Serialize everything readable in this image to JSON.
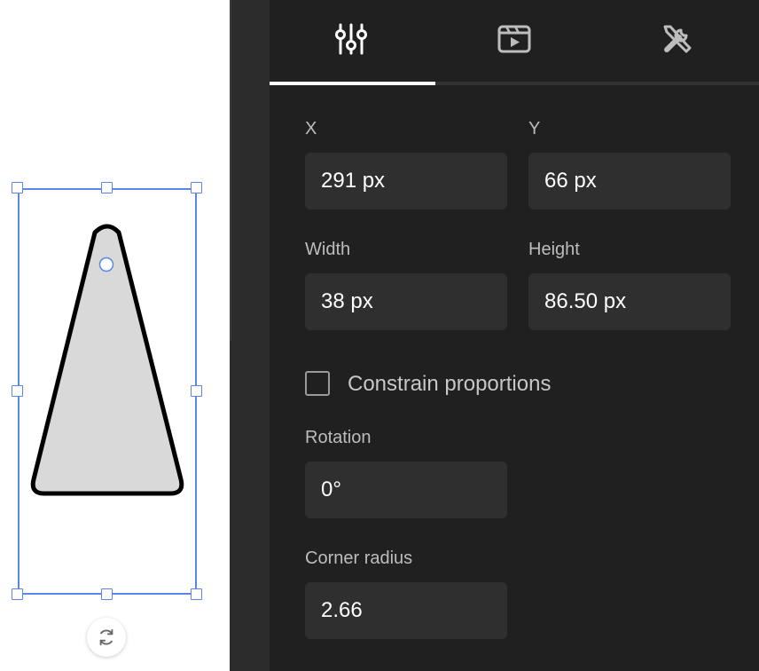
{
  "tabs": [
    {
      "icon": "sliders-icon",
      "active": true
    },
    {
      "icon": "video-clapper-icon",
      "active": false
    },
    {
      "icon": "tools-icon",
      "active": false
    }
  ],
  "position": {
    "x_label": "X",
    "x_value": "291 px",
    "y_label": "Y",
    "y_value": "66 px"
  },
  "size": {
    "width_label": "Width",
    "width_value": "38 px",
    "height_label": "Height",
    "height_value": "86.50 px"
  },
  "constrain": {
    "label": "Constrain proportions",
    "checked": false
  },
  "rotation": {
    "label": "Rotation",
    "value": "0°"
  },
  "corner": {
    "label": "Corner radius",
    "value": "2.66"
  },
  "colors": {
    "selection": "#5b86e5",
    "shape_fill": "#d9d9d9",
    "shape_stroke": "#000000",
    "panel_bg": "#202020",
    "field_bg": "#2f2f2f"
  }
}
